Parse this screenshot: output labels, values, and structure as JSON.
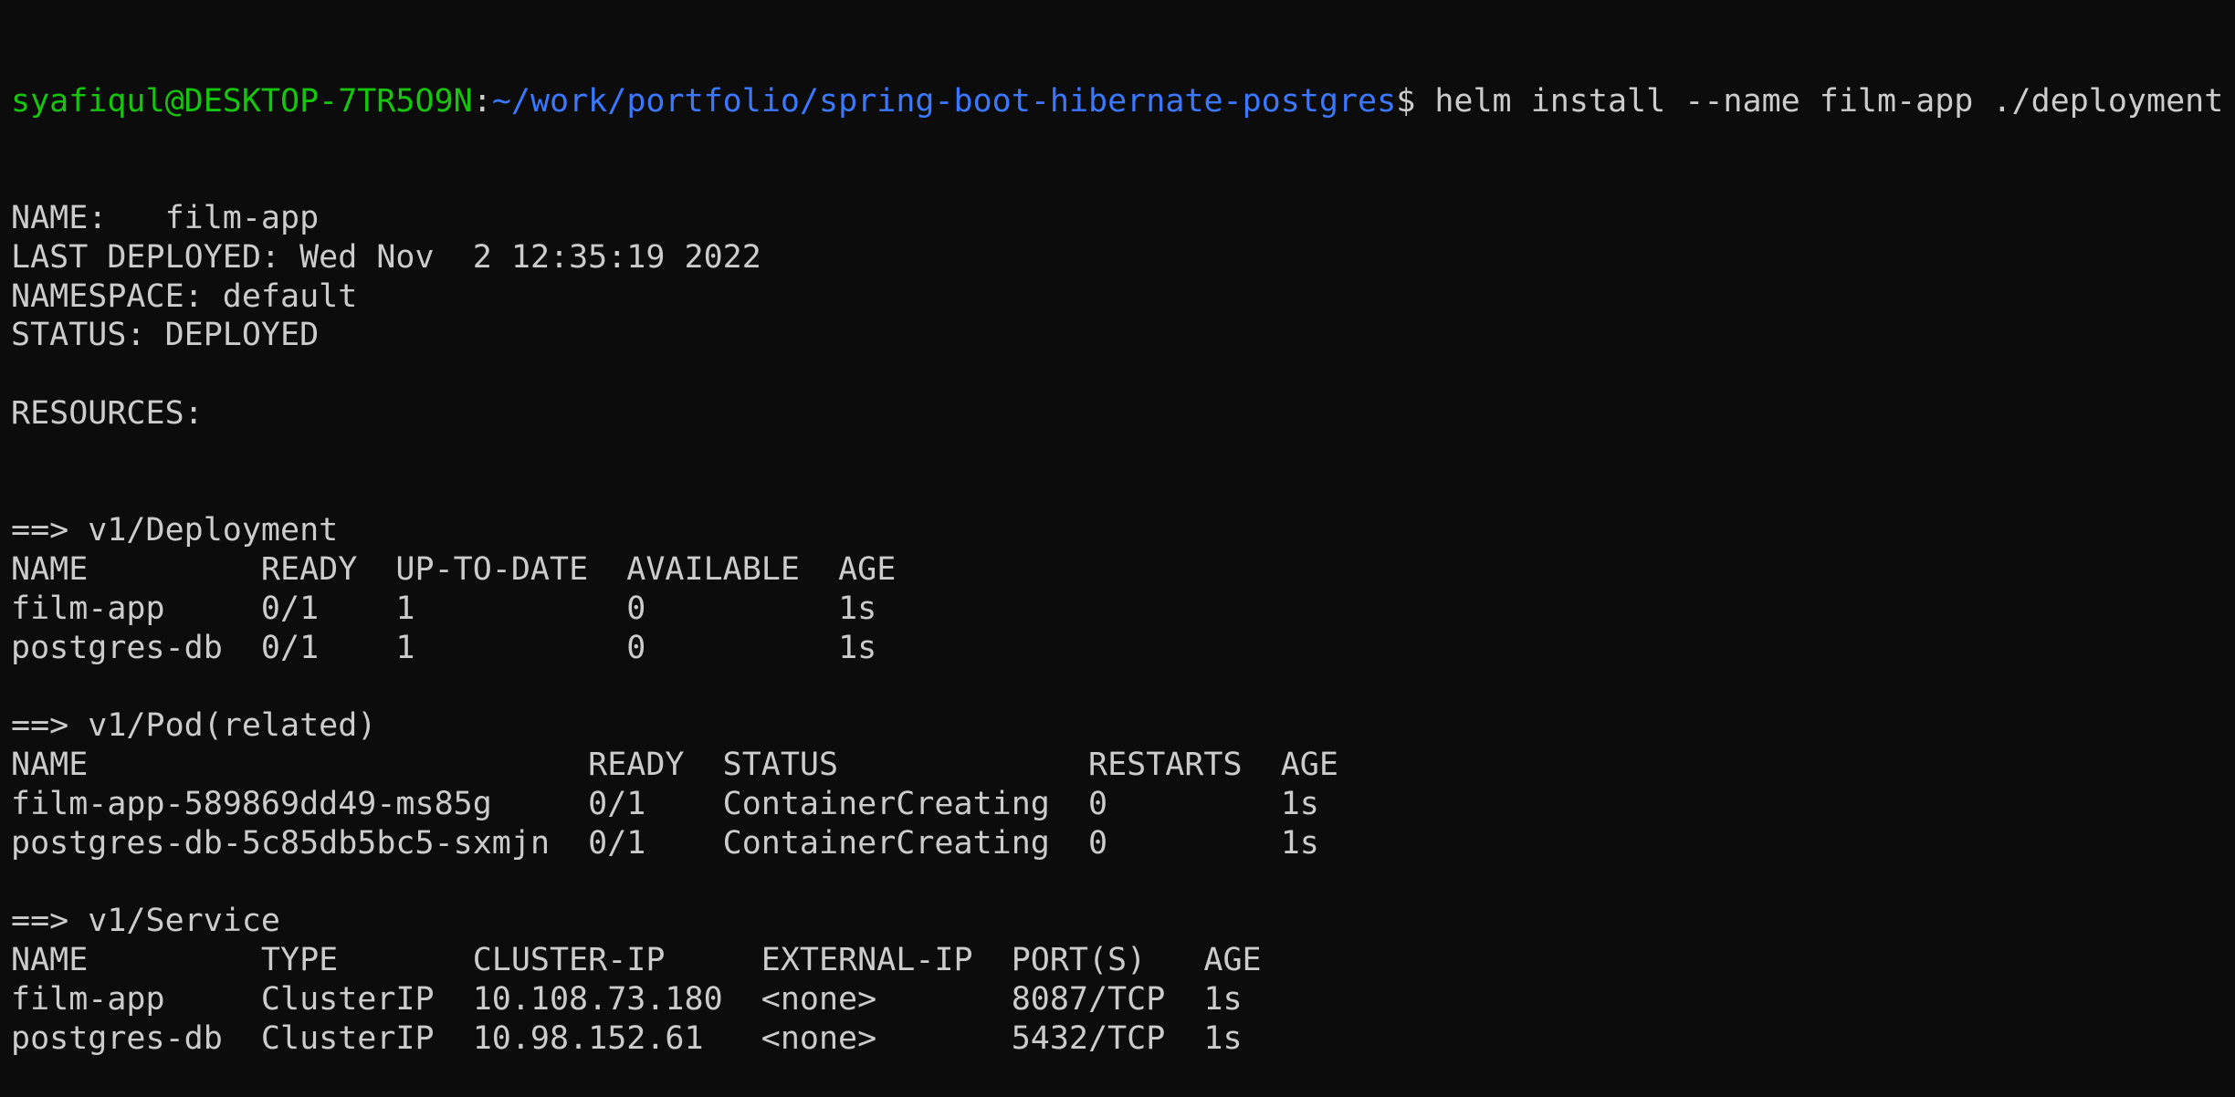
{
  "prompt": {
    "user_host": "syafiqul@DESKTOP-7TR5O9N",
    "sep": ":",
    "path": "~/work/portfolio/spring-boot-hibernate-postgres",
    "symbol": "$ ",
    "command": "helm install --name film-app ./deployment"
  },
  "colors": {
    "background": "#0c0c0c",
    "text": "#cccccc",
    "user": "#16c60c",
    "path": "#3b78ff"
  },
  "info": [
    "NAME:   film-app",
    "LAST DEPLOYED: Wed Nov  2 12:35:19 2022",
    "NAMESPACE: default",
    "STATUS: DEPLOYED",
    "",
    "RESOURCES:"
  ],
  "sections": [
    {
      "header": "==> v1/Deployment",
      "columns": [
        "NAME",
        "READY",
        "UP-TO-DATE",
        "AVAILABLE",
        "AGE"
      ],
      "rows": [
        [
          "film-app",
          "0/1",
          "1",
          "0",
          "1s"
        ],
        [
          "postgres-db",
          "0/1",
          "1",
          "0",
          "1s"
        ]
      ]
    },
    {
      "header": "==> v1/Pod(related)",
      "columns": [
        "NAME",
        "READY",
        "STATUS",
        "RESTARTS",
        "AGE"
      ],
      "rows": [
        [
          "film-app-589869dd49-ms85g",
          "0/1",
          "ContainerCreating",
          "0",
          "1s"
        ],
        [
          "postgres-db-5c85db5bc5-sxmjn",
          "0/1",
          "ContainerCreating",
          "0",
          "1s"
        ]
      ]
    },
    {
      "header": "==> v1/Service",
      "columns": [
        "NAME",
        "TYPE",
        "CLUSTER-IP",
        "EXTERNAL-IP",
        "PORT(S)",
        "AGE"
      ],
      "rows": [
        [
          "film-app",
          "ClusterIP",
          "10.108.73.180",
          "<none>",
          "8087/TCP",
          "1s"
        ],
        [
          "postgres-db",
          "ClusterIP",
          "10.98.152.61",
          "<none>",
          "5432/TCP",
          "1s"
        ]
      ]
    }
  ]
}
